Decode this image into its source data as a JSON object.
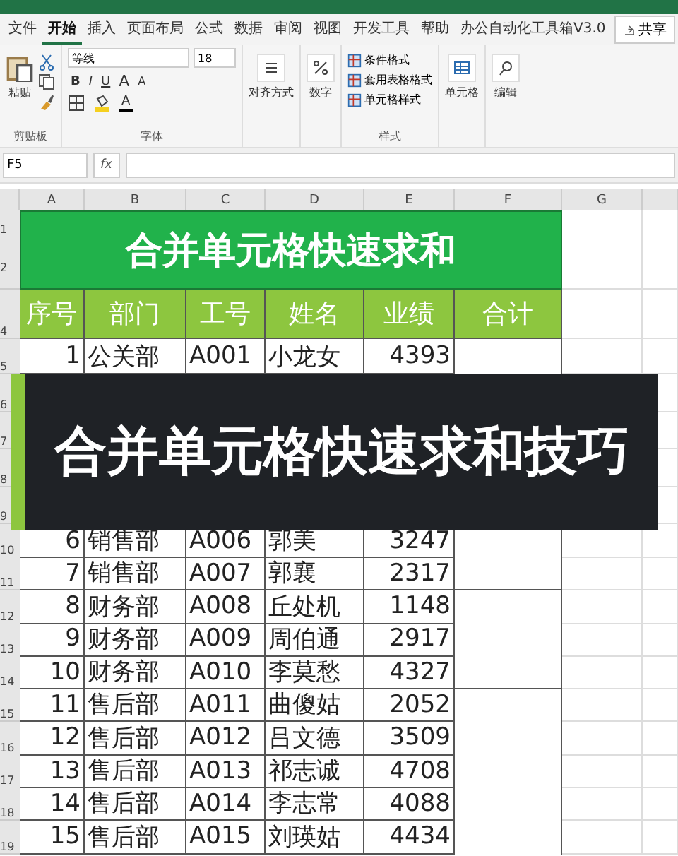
{
  "ribbon": {
    "tabs": [
      {
        "label": "文件",
        "selected": false
      },
      {
        "label": "开始",
        "selected": true
      },
      {
        "label": "插入",
        "selected": false
      },
      {
        "label": "页面布局",
        "selected": false
      },
      {
        "label": "公式",
        "selected": false
      },
      {
        "label": "数据",
        "selected": false
      },
      {
        "label": "审阅",
        "selected": false
      },
      {
        "label": "视图",
        "selected": false
      },
      {
        "label": "开发工具",
        "selected": false
      },
      {
        "label": "帮助",
        "selected": false
      },
      {
        "label": "办公自动化工具箱V3.0",
        "selected": false
      }
    ],
    "share_button": "共享",
    "clipboard": {
      "paste": "粘贴",
      "group_label": "剪贴板"
    },
    "font": {
      "name": "等线",
      "size": "18",
      "bold": "B",
      "italic": "I",
      "underline": "U",
      "grow": "A",
      "shrink": "A",
      "font_color": "A",
      "group_label": "字体"
    },
    "alignment": "对齐方式",
    "number": "数字",
    "styles": {
      "items": [
        "条件格式",
        "套用表格格式",
        "单元格样式"
      ],
      "group_label": "样式"
    },
    "cells": "单元格",
    "editing": "编辑"
  },
  "formula_bar": {
    "name_box": "F5",
    "fx": "fx"
  },
  "sheet": {
    "columns": [
      "A",
      "B",
      "C",
      "D",
      "E",
      "F",
      "G"
    ],
    "title_row_numbers": [
      "1",
      "2"
    ],
    "title": "合并单元格快速求和",
    "header_row_number": "4",
    "headers": [
      "序号",
      "部门",
      "工号",
      "姓名",
      "业绩",
      "合计"
    ],
    "rows": [
      {
        "number": "5",
        "cells": [
          "1",
          "公关部",
          "A001",
          "小龙女",
          "4393"
        ]
      },
      {
        "number": "6"
      },
      {
        "number": "7"
      },
      {
        "number": "8"
      },
      {
        "number": "9"
      },
      {
        "number": "10",
        "cells": [
          "6",
          "销售部",
          "A006",
          "郭美",
          "3247"
        ]
      },
      {
        "number": "11",
        "cells": [
          "7",
          "销售部",
          "A007",
          "郭襄",
          "2317"
        ],
        "group_end": true
      },
      {
        "number": "12",
        "cells": [
          "8",
          "财务部",
          "A008",
          "丘处机",
          "1148"
        ]
      },
      {
        "number": "13",
        "cells": [
          "9",
          "财务部",
          "A009",
          "周伯通",
          "2917"
        ]
      },
      {
        "number": "14",
        "cells": [
          "10",
          "财务部",
          "A010",
          "李莫愁",
          "4327"
        ],
        "group_end": true
      },
      {
        "number": "15",
        "cells": [
          "11",
          "售后部",
          "A011",
          "曲傻姑",
          "2052"
        ]
      },
      {
        "number": "16",
        "cells": [
          "12",
          "售后部",
          "A012",
          "吕文德",
          "3509"
        ]
      },
      {
        "number": "17",
        "cells": [
          "13",
          "售后部",
          "A013",
          "祁志诚",
          "4708"
        ]
      },
      {
        "number": "18",
        "cells": [
          "14",
          "售后部",
          "A014",
          "李志常",
          "4088"
        ]
      },
      {
        "number": "19",
        "cells": [
          "15",
          "售后部",
          "A015",
          "刘瑛姑",
          "4434"
        ]
      }
    ]
  },
  "banner": "合并单元格快速求和技巧"
}
